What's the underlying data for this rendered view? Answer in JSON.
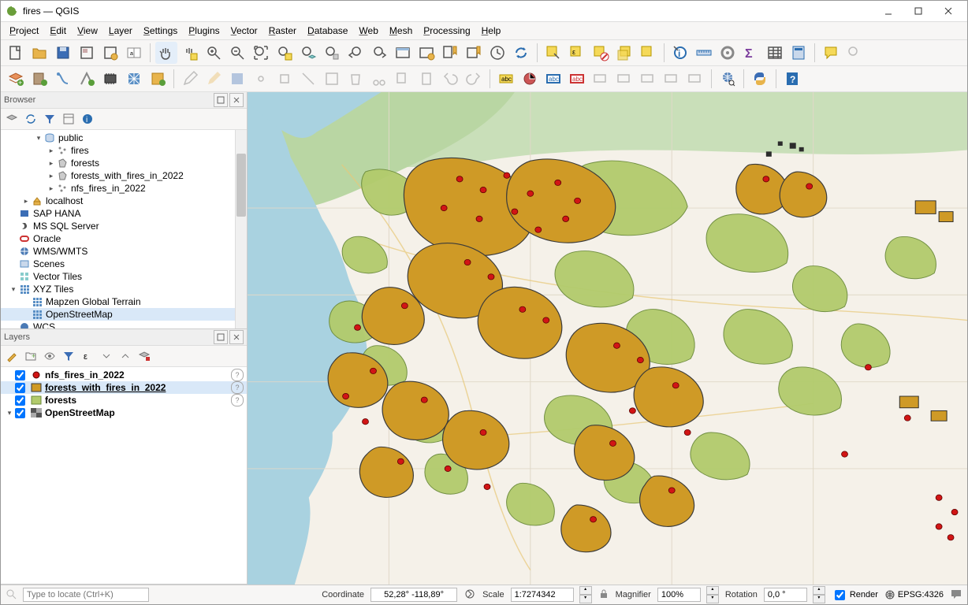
{
  "window": {
    "title": "fires — QGIS"
  },
  "menubar": [
    "Project",
    "Edit",
    "View",
    "Layer",
    "Settings",
    "Plugins",
    "Vector",
    "Raster",
    "Database",
    "Web",
    "Mesh",
    "Processing",
    "Help"
  ],
  "browser": {
    "title": "Browser",
    "tree": [
      {
        "indent": 2,
        "toggle": "▾",
        "icon": "schema",
        "label": "public"
      },
      {
        "indent": 3,
        "toggle": "▸",
        "icon": "points",
        "label": "fires"
      },
      {
        "indent": 3,
        "toggle": "▸",
        "icon": "polygon",
        "label": "forests"
      },
      {
        "indent": 3,
        "toggle": "▸",
        "icon": "polygon",
        "label": "forests_with_fires_in_2022"
      },
      {
        "indent": 3,
        "toggle": "▸",
        "icon": "points",
        "label": "nfs_fires_in_2022"
      },
      {
        "indent": 1,
        "toggle": "▸",
        "icon": "host",
        "label": "localhost"
      },
      {
        "indent": 0,
        "toggle": "",
        "icon": "saphana",
        "label": "SAP HANA"
      },
      {
        "indent": 0,
        "toggle": "",
        "icon": "mssql",
        "label": "MS SQL Server"
      },
      {
        "indent": 0,
        "toggle": "",
        "icon": "oracle",
        "label": "Oracle"
      },
      {
        "indent": 0,
        "toggle": "",
        "icon": "wms",
        "label": "WMS/WMTS"
      },
      {
        "indent": 0,
        "toggle": "",
        "icon": "scenes",
        "label": "Scenes"
      },
      {
        "indent": 0,
        "toggle": "",
        "icon": "vtile",
        "label": "Vector Tiles"
      },
      {
        "indent": 0,
        "toggle": "▾",
        "icon": "xyz",
        "label": "XYZ Tiles"
      },
      {
        "indent": 1,
        "toggle": "",
        "icon": "xyz",
        "label": "Mapzen Global Terrain"
      },
      {
        "indent": 1,
        "toggle": "",
        "icon": "xyz",
        "label": "OpenStreetMap",
        "selected": true
      },
      {
        "indent": 0,
        "toggle": "",
        "icon": "wcs",
        "label": "WCS"
      }
    ]
  },
  "layers": {
    "title": "Layers",
    "items": [
      {
        "checked": true,
        "sym": "point-red",
        "label": "nfs_fires_in_2022",
        "info": true
      },
      {
        "checked": true,
        "sym": "poly-orange",
        "label": "forests_with_fires_in_2022",
        "underline": true,
        "selected": true,
        "info": true
      },
      {
        "checked": true,
        "sym": "poly-green",
        "label": "forests",
        "info": true
      },
      {
        "group": true,
        "checked": true,
        "sym": "raster",
        "label": "OpenStreetMap"
      }
    ]
  },
  "locator_placeholder": "Type to locate (Ctrl+K)",
  "status": {
    "coord_label": "Coordinate",
    "coord_value": "52,28° -118,89°",
    "scale_label": "Scale",
    "scale_value": "1:7274342",
    "mag_label": "Magnifier",
    "mag_value": "100%",
    "rot_label": "Rotation",
    "rot_value": "0,0 °",
    "render_label": "Render",
    "crs": "EPSG:4326"
  },
  "map": {
    "colors": {
      "ocean": "#a9d2e0",
      "land": "#f5f1e9",
      "landgreen": "#d5e7c8",
      "forest": "#b2cb6c",
      "forest_fire": "#cf9a26",
      "fire_point": "#d11515"
    }
  }
}
